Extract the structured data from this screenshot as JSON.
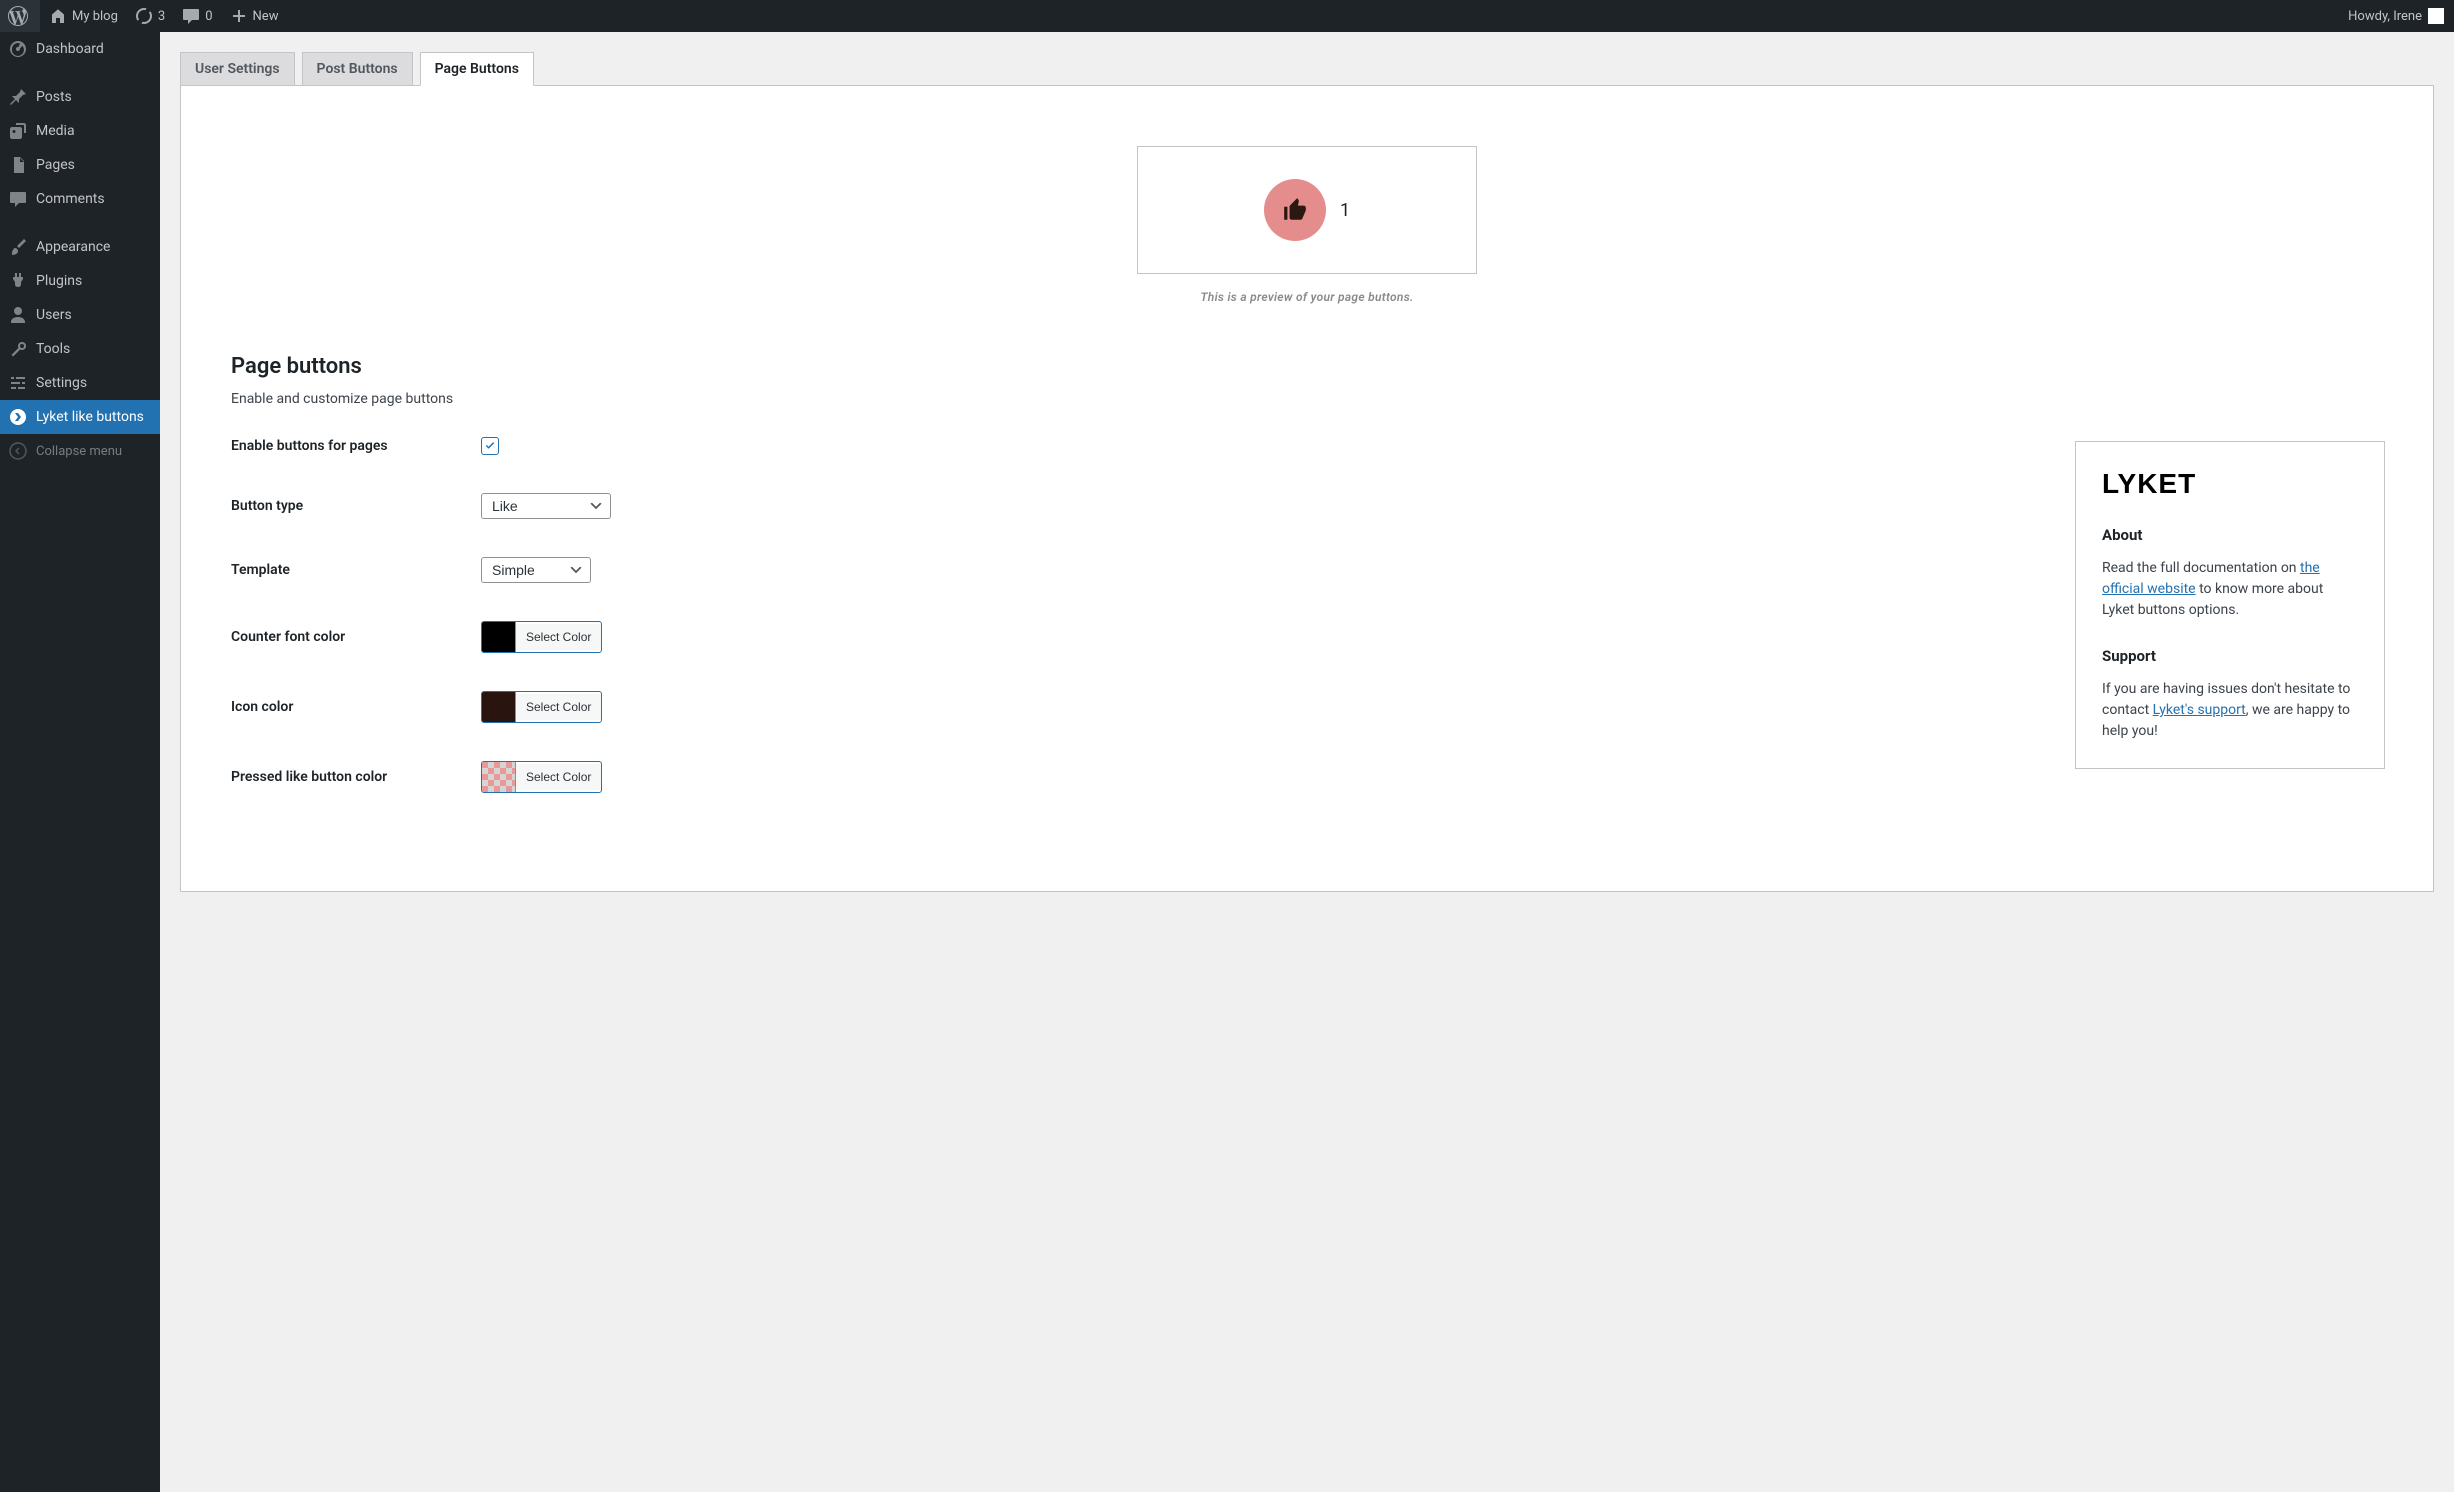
{
  "adminbar": {
    "site_name": "My blog",
    "updates_count": "3",
    "comments_count": "0",
    "new_label": "New",
    "howdy": "Howdy, Irene"
  },
  "sidebar": {
    "items": [
      {
        "label": "Dashboard"
      },
      {
        "label": "Posts"
      },
      {
        "label": "Media"
      },
      {
        "label": "Pages"
      },
      {
        "label": "Comments"
      },
      {
        "label": "Appearance"
      },
      {
        "label": "Plugins"
      },
      {
        "label": "Users"
      },
      {
        "label": "Tools"
      },
      {
        "label": "Settings"
      },
      {
        "label": "Lyket like buttons"
      }
    ],
    "collapse": "Collapse menu"
  },
  "tabs": [
    "User Settings",
    "Post Buttons",
    "Page Buttons"
  ],
  "preview": {
    "count": "1",
    "caption": "This is a preview of your page buttons."
  },
  "form": {
    "heading": "Page buttons",
    "desc": "Enable and customize page buttons",
    "enable_label": "Enable buttons for pages",
    "button_type_label": "Button type",
    "button_type_value": "Like",
    "template_label": "Template",
    "template_value": "Simple",
    "counter_color_label": "Counter font color",
    "icon_color_label": "Icon color",
    "pressed_color_label": "Pressed like button color",
    "select_color": "Select Color",
    "colors": {
      "counter": "#000000",
      "icon": "#2a1410",
      "pressed": "#e99898"
    }
  },
  "lyket": {
    "logo": "LYKET",
    "about_h": "About",
    "about_pre": "Read the full documentation on ",
    "about_link": "the official website",
    "about_post": " to know more about Lyket buttons options.",
    "support_h": "Support",
    "support_pre": "If you are having issues don't hesitate to contact ",
    "support_link": "Lyket's support",
    "support_post": ", we are happy to help you!"
  }
}
